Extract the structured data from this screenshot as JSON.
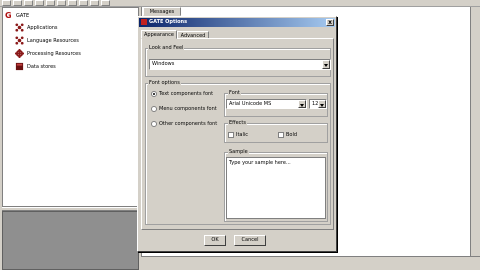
{
  "tree": {
    "root": "GATE",
    "items": [
      {
        "label": "Applications"
      },
      {
        "label": "Language Resources"
      },
      {
        "label": "Processing Resources"
      },
      {
        "label": "Data stores"
      }
    ]
  },
  "main": {
    "messages_tab": "Messages"
  },
  "dialog": {
    "title": "GATE Options",
    "close_glyph": "x",
    "tabs": [
      {
        "label": "Appearance"
      },
      {
        "label": "Advanced"
      }
    ],
    "look_and_feel": {
      "label": "Look and Feel",
      "value": "Windows"
    },
    "font_options": {
      "label": "Font options",
      "radios": [
        {
          "label": "Text components font",
          "selected": true
        },
        {
          "label": "Menu components font",
          "selected": false
        },
        {
          "label": "Other components font",
          "selected": false
        }
      ]
    },
    "font": {
      "label": "Font",
      "family": "Arial Unicode MS",
      "size": "12"
    },
    "effects": {
      "label": "Effects",
      "italic": "Italic",
      "bold": "Bold"
    },
    "sample": {
      "label": "Sample",
      "text": "Type your sample here..."
    },
    "ok_label": "OK",
    "cancel_label": "Cancel"
  },
  "colors": {
    "title_start": "#0a246a",
    "title_end": "#a6caf0",
    "brand_red": "#b01010"
  }
}
